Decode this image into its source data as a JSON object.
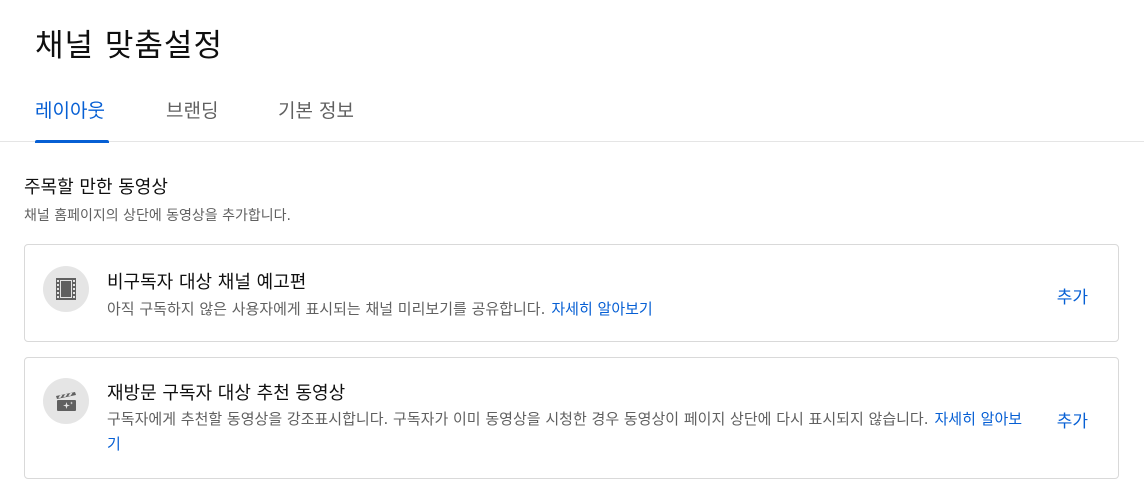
{
  "page": {
    "title": "채널 맞춤설정"
  },
  "tabs": [
    {
      "label": "레이아웃",
      "active": true
    },
    {
      "label": "브랜딩",
      "active": false
    },
    {
      "label": "기본 정보",
      "active": false
    }
  ],
  "featured_section": {
    "title": "주목할 만한 동영상",
    "description": "채널 홈페이지의 상단에 동영상을 추가합니다."
  },
  "cards": [
    {
      "icon": "film-icon",
      "title": "비구독자 대상 채널 예고편",
      "description": "아직 구독하지 않은 사용자에게 표시되는 채널 미리보기를 공유합니다.",
      "link": "자세히 알아보기",
      "action": "추가"
    },
    {
      "icon": "clapperboard-sparkle-icon",
      "title": "재방문 구독자 대상 추천 동영상",
      "description": "구독자에게 추천할 동영상을 강조표시합니다. 구독자가 이미 동영상을 시청한 경우 동영상이 페이지 상단에 다시 표시되지 않습니다.",
      "link": "자세히 알아보기",
      "action": "추가"
    }
  ],
  "colors": {
    "accent": "#065fd4",
    "text_primary": "#0f0f0f",
    "text_secondary": "#606060",
    "border": "#d9d9d9",
    "icon_bg": "#e5e5e5"
  }
}
